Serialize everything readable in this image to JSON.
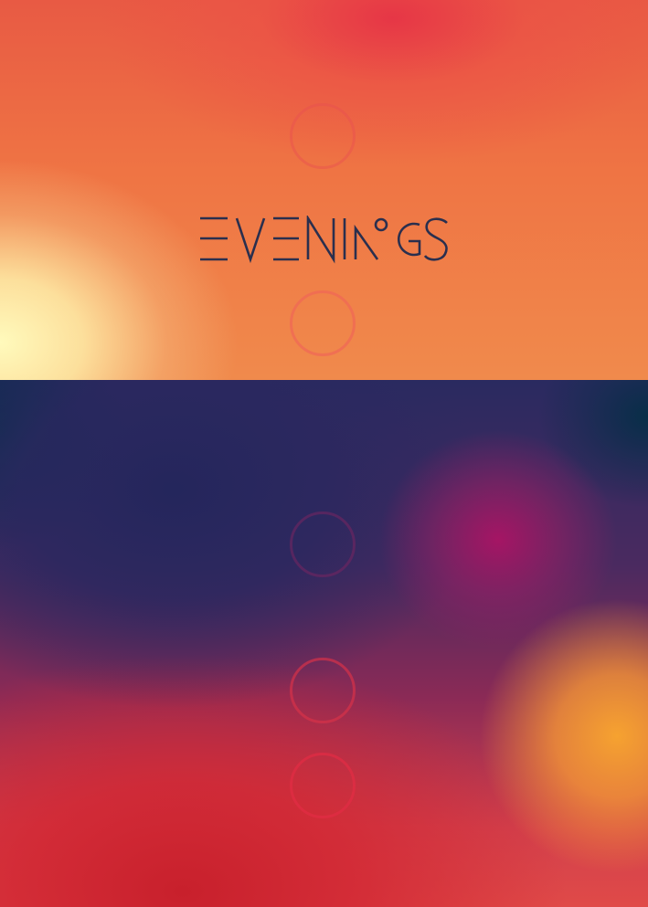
{
  "poster": {
    "wordmark": "EVENINGS",
    "colors": {
      "wordmark": "#2a2f4e",
      "sunset_orange": "#ef7444",
      "sunset_yellow": "#fffabc",
      "sunset_red": "#e6324a",
      "night_navy": "#24265c",
      "night_teal": "#003046",
      "night_magenta": "#aa1464",
      "night_amber": "#f6a230"
    },
    "icons": [
      "ring-outline-icon",
      "ring-outline-icon",
      "ring-outline-icon",
      "ring-outline-icon",
      "ring-outline-icon"
    ]
  }
}
